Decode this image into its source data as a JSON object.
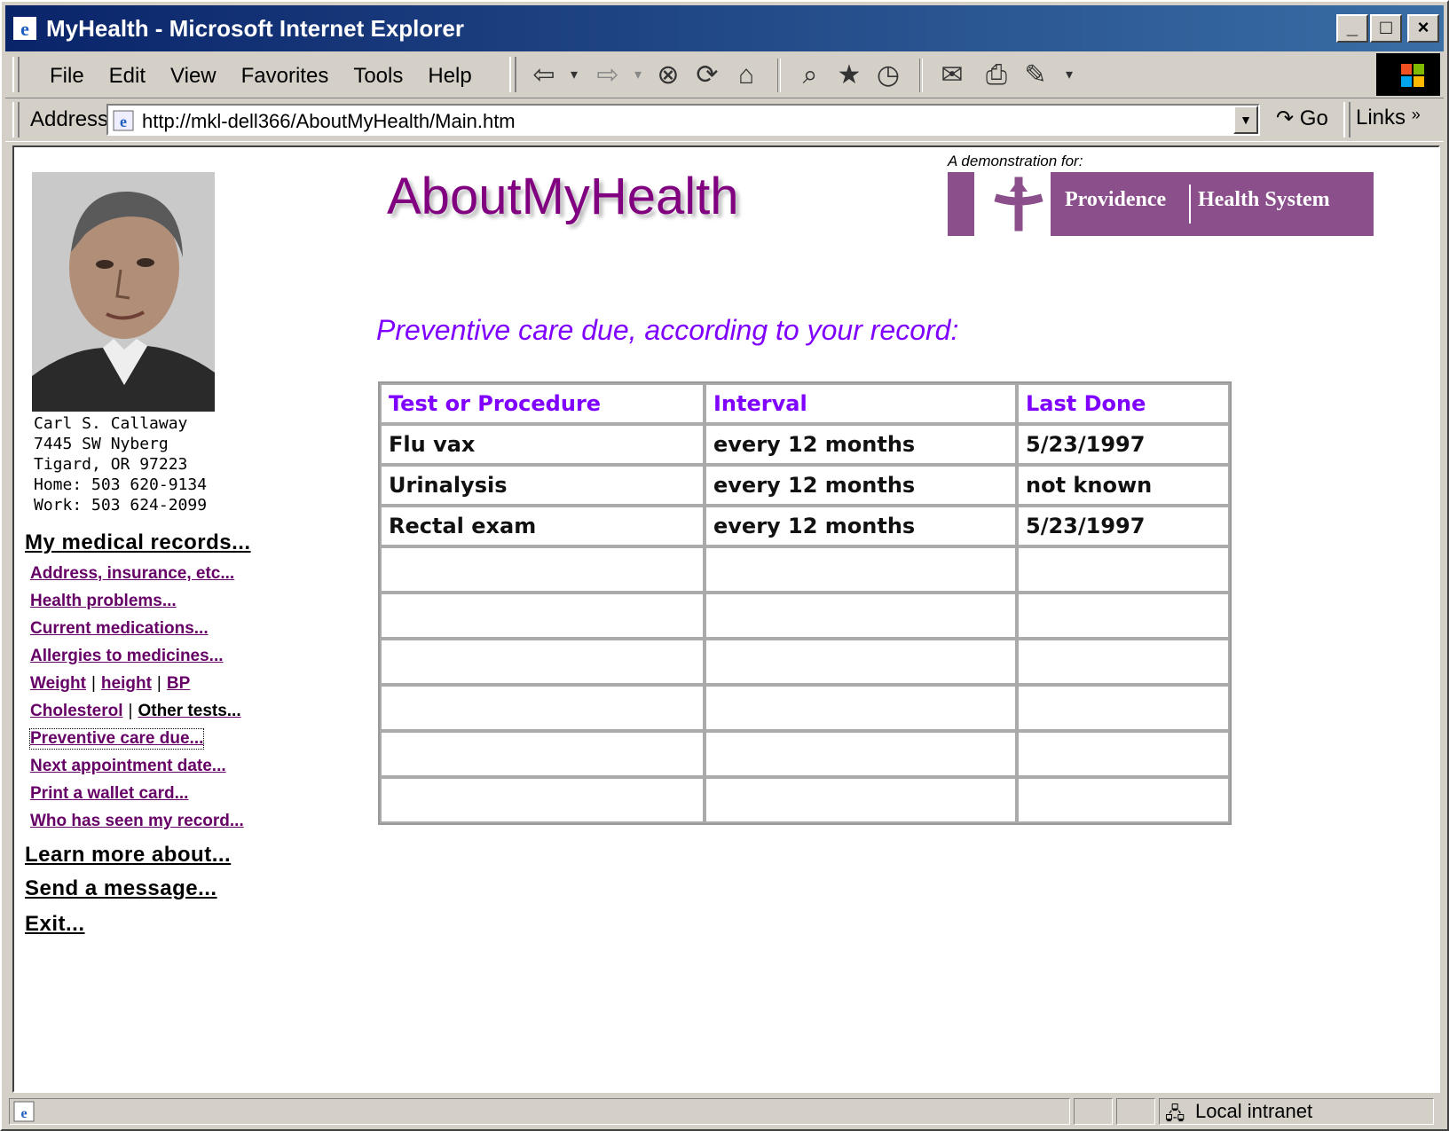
{
  "window": {
    "title": "MyHealth - Microsoft Internet Explorer"
  },
  "menu": [
    "File",
    "Edit",
    "View",
    "Favorites",
    "Tools",
    "Help"
  ],
  "address": {
    "label": "Address",
    "url": "http://mkl-dell366/AboutMyHealth/Main.htm",
    "go": "Go",
    "links": "Links"
  },
  "patient": {
    "name": "Carl S. Callaway",
    "street": "7445 SW Nyberg",
    "city": "Tigard, OR 97223",
    "home": "Home: 503 620-9134",
    "work": "Work: 503 624-2099"
  },
  "nav": {
    "records": "My medical records...",
    "address_ins": "Address, insurance, etc...",
    "problems": "Health problems...",
    "medications": "Current medications...",
    "allergies": "Allergies to medicines...",
    "weight": "Weight",
    "height": "height",
    "bp": "BP",
    "cholesterol": "Cholesterol",
    "other_tests": "Other tests...",
    "preventive": "Preventive care due...",
    "appointment": "Next appointment date...",
    "wallet": "Print a wallet card...",
    "who_seen": "Who has seen my record...",
    "learn": "Learn more about...",
    "send": "Send a message...",
    "exit": "Exit..."
  },
  "header": {
    "brand": "AboutMyHealth",
    "demo_label": "A demonstration for:",
    "org_part1": "Providence",
    "org_part2": "Health System"
  },
  "section_title": "Preventive care due, according to your record:",
  "table": {
    "headers": [
      "Test or Procedure",
      "Interval",
      "Last Done"
    ],
    "rows": [
      [
        "Flu vax",
        "every 12 months",
        "5/23/1997"
      ],
      [
        "Urinalysis",
        "every 12 months",
        "not known"
      ],
      [
        "Rectal exam",
        "every 12 months",
        "5/23/1997"
      ]
    ]
  },
  "status": {
    "zone": "Local intranet"
  },
  "colors": {
    "brand": "#800080",
    "accent": "#7f00ff",
    "link": "#660066",
    "title_bar": "#0a246a"
  }
}
